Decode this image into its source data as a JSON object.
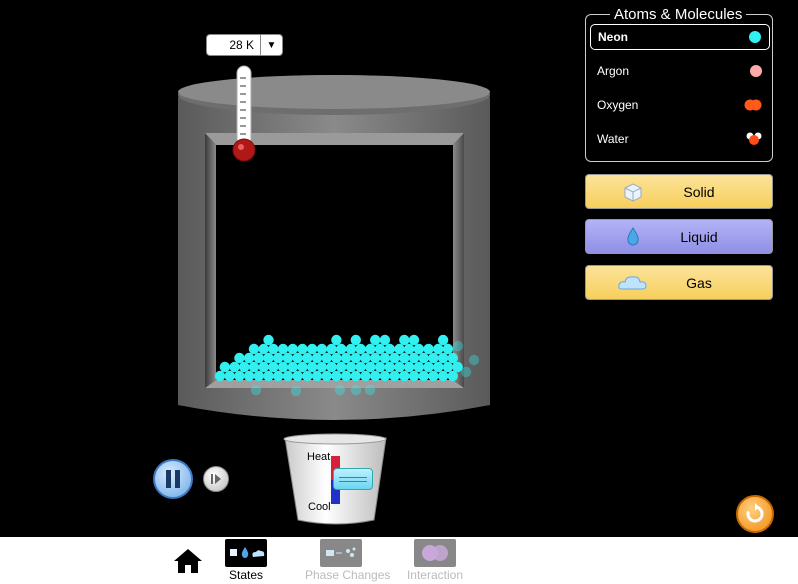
{
  "thermometer": {
    "value": "28 K",
    "dropdown_glyph": "▼"
  },
  "panel": {
    "title": "Atoms & Molecules",
    "species": [
      {
        "label": "Neon",
        "color": "#33f0f0",
        "selected": true
      },
      {
        "label": "Argon",
        "color": "#ffaaaa",
        "selected": false
      },
      {
        "label": "Oxygen",
        "color": "#ff5a1a",
        "selected": false
      },
      {
        "label": "Water",
        "color": "#ff4d1a",
        "selected": false
      }
    ]
  },
  "states": {
    "solid": "Solid",
    "liquid": "Liquid",
    "gas": "Gas"
  },
  "heater": {
    "heat_label": "Heat",
    "cool_label": "Cool",
    "level": 0.5
  },
  "playback": {
    "paused": false
  },
  "nav": {
    "tabs": [
      {
        "label": "States",
        "active": true
      },
      {
        "label": "Phase Changes",
        "active": false
      },
      {
        "label": "Interaction",
        "active": false
      }
    ]
  },
  "colors": {
    "particle": "#33f0f0",
    "container": "#7a7a7a",
    "background": "#000000"
  }
}
